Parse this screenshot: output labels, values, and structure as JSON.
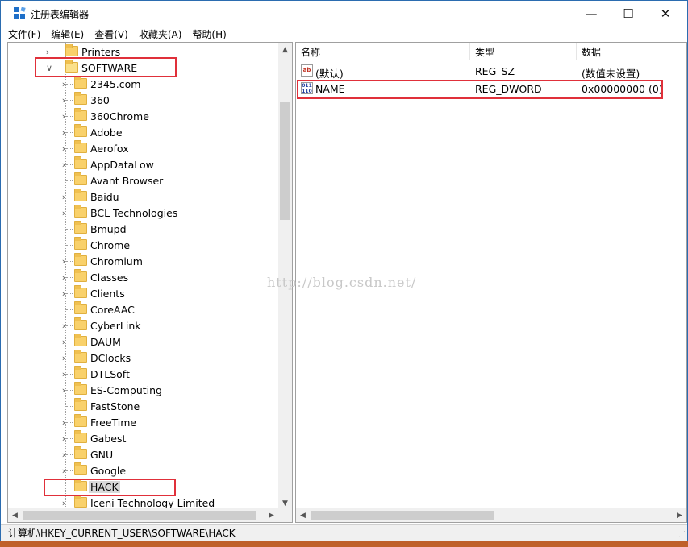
{
  "window": {
    "title": "注册表编辑器",
    "minimize": "—",
    "maximize": "☐",
    "close": "✕"
  },
  "menu": [
    "文件(F)",
    "编辑(E)",
    "查看(V)",
    "收藏夹(A)",
    "帮助(H)"
  ],
  "tree": {
    "parent_items": [
      {
        "label": "Printers",
        "expanded": false
      },
      {
        "label": "SOFTWARE",
        "expanded": true
      }
    ],
    "children": [
      {
        "label": "2345.com",
        "has_children": true
      },
      {
        "label": "360",
        "has_children": true
      },
      {
        "label": "360Chrome",
        "has_children": true
      },
      {
        "label": "Adobe",
        "has_children": true
      },
      {
        "label": "Aerofox",
        "has_children": true
      },
      {
        "label": "AppDataLow",
        "has_children": true
      },
      {
        "label": "Avant Browser",
        "has_children": false
      },
      {
        "label": "Baidu",
        "has_children": true
      },
      {
        "label": "BCL Technologies",
        "has_children": true
      },
      {
        "label": "Bmupd",
        "has_children": false
      },
      {
        "label": "Chrome",
        "has_children": false
      },
      {
        "label": "Chromium",
        "has_children": true
      },
      {
        "label": "Classes",
        "has_children": true
      },
      {
        "label": "Clients",
        "has_children": true
      },
      {
        "label": "CoreAAC",
        "has_children": false
      },
      {
        "label": "CyberLink",
        "has_children": true
      },
      {
        "label": "DAUM",
        "has_children": true
      },
      {
        "label": "DClocks",
        "has_children": true
      },
      {
        "label": "DTLSoft",
        "has_children": true
      },
      {
        "label": "ES-Computing",
        "has_children": true
      },
      {
        "label": "FastStone",
        "has_children": false
      },
      {
        "label": "FreeTime",
        "has_children": true
      },
      {
        "label": "Gabest",
        "has_children": true
      },
      {
        "label": "GNU",
        "has_children": true
      },
      {
        "label": "Google",
        "has_children": true
      },
      {
        "label": "HACK",
        "has_children": false,
        "selected": true
      },
      {
        "label": "Iceni Technology Limited",
        "has_children": true
      }
    ]
  },
  "list": {
    "columns": [
      "名称",
      "类型",
      "数据"
    ],
    "rows": [
      {
        "icon": "string-value-icon",
        "icon_text": "ab",
        "name": "(默认)",
        "type": "REG_SZ",
        "data": "(数值未设置)"
      },
      {
        "icon": "dword-value-icon",
        "icon_text": "011\n110",
        "name": "NAME",
        "type": "REG_DWORD",
        "data": "0x00000000 (0)"
      }
    ]
  },
  "watermark": "http://blog.csdn.net/",
  "statusbar": {
    "path": "计算机\\HKEY_CURRENT_USER\\SOFTWARE\\HACK"
  },
  "colors": {
    "highlight": "#e0303a",
    "folder": "#f9d16b",
    "accent": "#2b6cb0"
  }
}
